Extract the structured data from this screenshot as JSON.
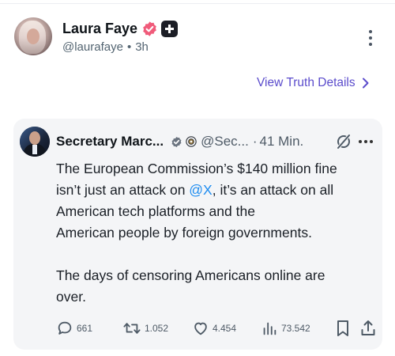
{
  "post": {
    "author_name": "Laura Faye",
    "handle": "@laurafaye",
    "separator": "•",
    "time_ago": "3h",
    "view_details": "View Truth Details"
  },
  "quote": {
    "author_name": "Secretary Marc...",
    "handle": "@Sec...",
    "separator": "·",
    "time": "41 Min.",
    "text_lines": [
      "The European Commission’s $140 million fine",
      "isn’t just an attack on ",
      "@X",
      ", it’s an attack on all",
      "American tech platforms and the",
      "American people by foreign governments.",
      "The days of censoring Americans online are",
      "over."
    ],
    "stats": {
      "replies": "661",
      "reposts": "1.052",
      "likes": "4.454",
      "views": "73.542"
    }
  },
  "colors": {
    "accent_link": "#5b4ccc",
    "verified_badge": "#f05b7a",
    "mention": "#1d8cf0",
    "card_background": "#f4f5f7"
  },
  "icons": [
    "verified-badge-icon",
    "plus-badge-icon",
    "kebab-menu-icon",
    "chevron-right-icon",
    "gray-check-icon",
    "government-seal-icon",
    "edited-icon",
    "more-icon",
    "reply-icon",
    "repost-icon",
    "like-icon",
    "views-icon",
    "bookmark-icon",
    "share-icon"
  ]
}
